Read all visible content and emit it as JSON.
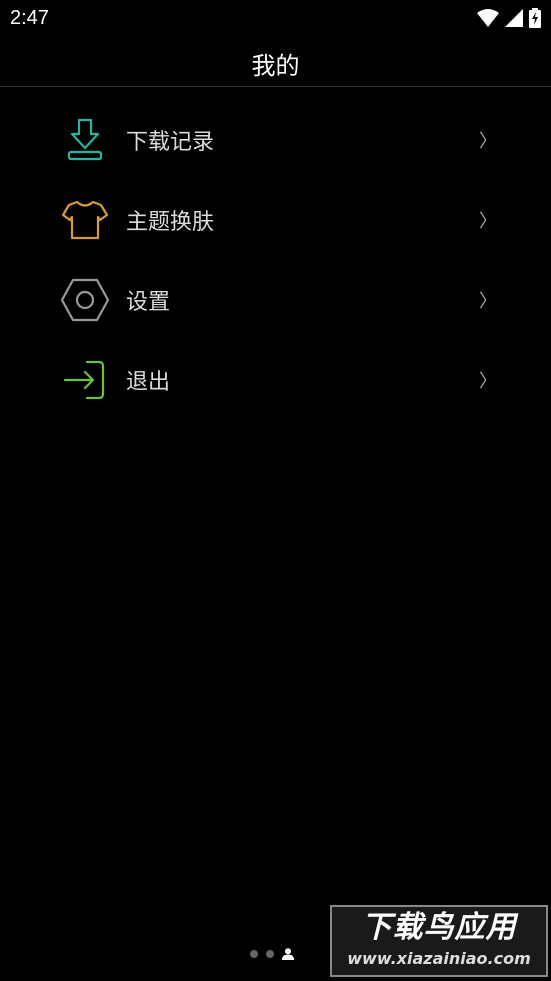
{
  "status_bar": {
    "time": "2:47",
    "icons": [
      "wifi-icon",
      "signal-icon",
      "battery-charging-icon"
    ]
  },
  "header": {
    "title": "我的"
  },
  "menu": {
    "items": [
      {
        "label": "下载记录",
        "icon": "download-icon",
        "icon_color": "#2bb3a0",
        "chevron": "〉"
      },
      {
        "label": "主题换肤",
        "icon": "shirt-icon",
        "icon_color": "#d89a3e",
        "chevron": "〉"
      },
      {
        "label": "设置",
        "icon": "settings-hexagon-icon",
        "icon_color": "#9a9a9a",
        "chevron": "〉"
      },
      {
        "label": "退出",
        "icon": "exit-icon",
        "icon_color": "#6cbf45",
        "chevron": "〉"
      }
    ]
  },
  "page_indicator": {
    "pages": 3,
    "active": 3
  },
  "watermark": {
    "title": "下载鸟应用",
    "url": "www.xiazainiao.com"
  }
}
